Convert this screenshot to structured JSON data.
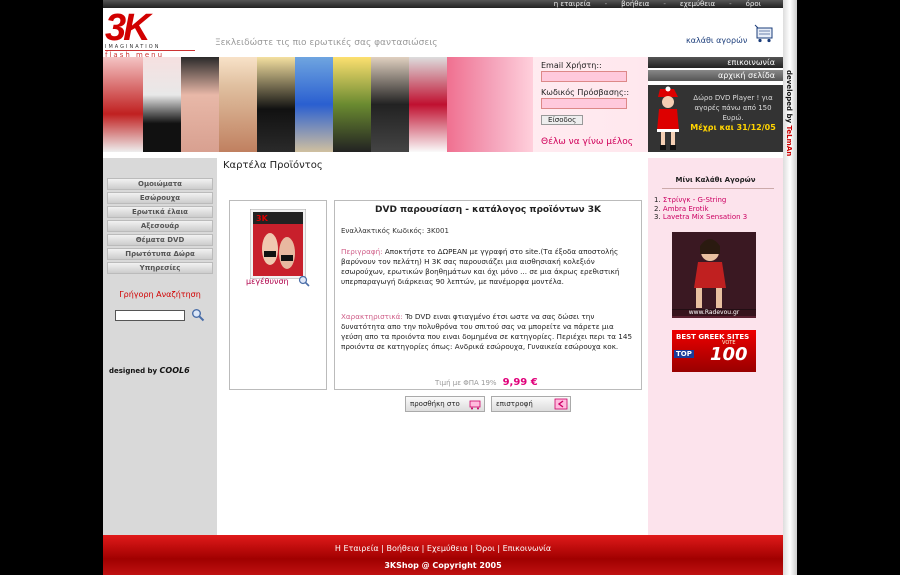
{
  "topnav": [
    {
      "label": "η εταιρεία"
    },
    {
      "label": "βοήθεια"
    },
    {
      "label": "εχεμύθεια"
    },
    {
      "label": "όροι"
    }
  ],
  "header": {
    "logo_text": "3K",
    "logo_sub": "IMAGINATION",
    "flash_menu": "flash menu",
    "slogan": "Ξεκλειδώστε τις πιο ερωτικές σας φαντασιώσεις",
    "cart_link": "καλάθι αγορών"
  },
  "login": {
    "email_label": "Email Χρήστη::",
    "password_label": "Κωδικός Πρόσβασης::",
    "submit_label": "Είσοδος",
    "member_link": "Θέλω να γίνω μέλος"
  },
  "right_top": {
    "contact_tab": "επικοινωνία",
    "home_tab": "αρχική σελίδα",
    "promo_text": "Δώρο DVD Player ! για αγορές πάνω από 150 Ευρώ.",
    "promo_date": "Μέχρι και 31/12/05"
  },
  "developer": {
    "prefix": "developed by",
    "name": "TeLmAn"
  },
  "sidebar": {
    "menu": [
      {
        "label": "Ομοιώματα"
      },
      {
        "label": "Εσώρουχα"
      },
      {
        "label": "Ερωτικά έλαια"
      },
      {
        "label": "Αξεσουάρ"
      },
      {
        "label": "Θέματα DVD"
      },
      {
        "label": "Πρωτότυπα Δώρα"
      },
      {
        "label": "Υπηρεσίες"
      }
    ],
    "quick_search": "Γρήγορη Αναζήτηση",
    "designed_by": "designed by",
    "designer": "COOL6"
  },
  "main": {
    "page_title": "Καρτέλα Προϊόντος",
    "enlarge": "μεγέθυνση",
    "product_title": "DVD παρουσίαση - κατάλογος προϊόντων 3K",
    "code_label": "Εναλλακτικός Κωδικός:",
    "code_value": "3K001",
    "desc_label": "Περιγραφή:",
    "desc_text": " Αποκτήστε το ΔΩΡΕΑΝ με γγραφή στο site.(Τα έξοδα αποστολής βαρύνουν τον πελάτη) Η 3Κ σας παρουσιάζει μια αισθησιακή κολεξιόν εσωρούχων, ερωτικών βοηθημάτων και όχι μόνο ... σε μια άκρως ερεθιστική υπερπαραγωγή διάρκειας 90 λεπτών, με πανέμορφα μοντέλα.",
    "feat_label": "Χαρακτηριστικά:",
    "feat_text": " To DVD ειναι φτιαγμένο έτσι ωστε να σας δώσει την δυνατότητα απο την πολυθρόνα του σπιτού σας να μπορείτε να πάρετε μια γεύση απο τα προιόντα που ειναι δομημένα σε κατηγορίες. Περιέχει περι τα 145 προιόντα σε κατηγορίες όπως: Ανδρικά εσώρουχα, Γυναικεία εσώρουχα κοκ.",
    "price_label": "Τιμή με ΦΠΑ 19%",
    "price_value": "9,99 €",
    "add_button": "προσθήκη στο",
    "back_button": "επιστροφή"
  },
  "minicart": {
    "title": "Μίνι Καλάθι Αγορών",
    "items": [
      {
        "num": "1.",
        "name": "Στρίνγκ - G-String"
      },
      {
        "num": "2.",
        "name": "Ambra Erotik"
      },
      {
        "num": "3.",
        "name": "Lavetra Mix Sensation 3"
      }
    ],
    "ad1_url": "www.Radevou.gr",
    "ad2_line1": "BEST GREEK SITES",
    "ad2_top": "TOP",
    "ad2_num": "100",
    "ad2_vote": "VOTE"
  },
  "footer": {
    "links": [
      {
        "label": "Η Εταιρεία"
      },
      {
        "label": "Βοήθεια"
      },
      {
        "label": "Εχεμύθεια"
      },
      {
        "label": "Όροι"
      },
      {
        "label": "Επικοινωνία"
      }
    ],
    "copyright": "3KShop @ Copyright 2005"
  },
  "colors": {
    "brand_red": "#d10000",
    "pink": "#e0007a",
    "sidebar_pink": "#fce3ec"
  }
}
